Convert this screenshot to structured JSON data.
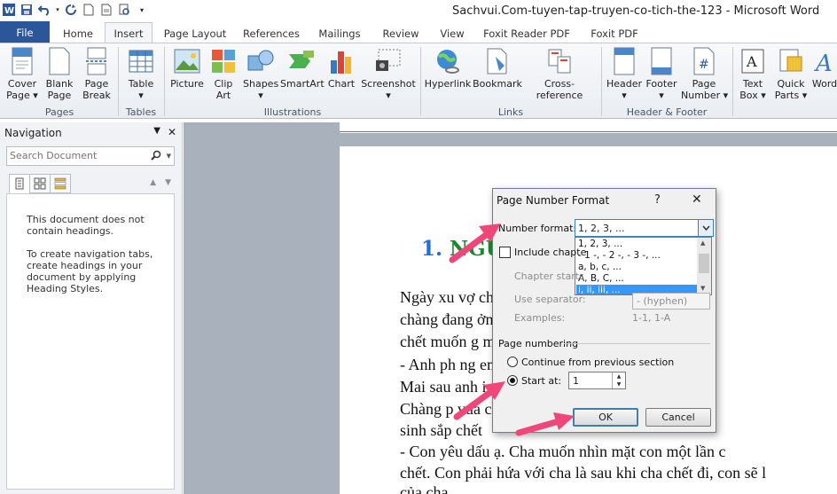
{
  "window": {
    "title": "Sachvui.Com-tuyen-tap-truyen-co-tich-the-123  -  Microsoft Word"
  },
  "tabs": [
    {
      "label": "File"
    },
    {
      "label": "Home"
    },
    {
      "label": "Insert"
    },
    {
      "label": "Page Layout"
    },
    {
      "label": "References"
    },
    {
      "label": "Mailings"
    },
    {
      "label": "Review"
    },
    {
      "label": "View"
    },
    {
      "label": "Foxit Reader PDF"
    },
    {
      "label": "Foxit PDF"
    }
  ],
  "ribbon": {
    "pages": {
      "label": "Pages",
      "cover": "Cover\nPage ▾",
      "blank": "Blank\nPage",
      "break": "Page\nBreak"
    },
    "tables": {
      "label": "Tables",
      "table": "Table\n▾"
    },
    "illustrations": {
      "label": "Illustrations",
      "picture": "Picture",
      "clipart": "Clip\nArt",
      "shapes": "Shapes\n▾",
      "smartart": "SmartArt",
      "chart": "Chart",
      "screenshot": "Screenshot\n▾"
    },
    "links": {
      "label": "Links",
      "hyperlink": "Hyperlink",
      "bookmark": "Bookmark",
      "crossref": "Cross-reference"
    },
    "header_footer": {
      "label": "Header & Footer",
      "header": "Header\n▾",
      "footer": "Footer\n▾",
      "pagenumber": "Page\nNumber ▾"
    },
    "text": {
      "textbox": "Text\nBox ▾",
      "quickparts": "Quick\nParts ▾",
      "wordart": "Word"
    }
  },
  "navigation": {
    "title": "Navigation",
    "search_placeholder": "Search Document",
    "msg1": "This document does not contain headings.",
    "msg2": "To create navigation tabs, create headings in your document by applying Heading Styles."
  },
  "document": {
    "heading_num": "1.",
    "heading_text": "NGU",
    "lines": [
      "Ngày xu                                    vợ chưa cưới th",
      "chàng đang                                ởng thì nhận đ",
      "chết muốn g                               mắt. Chàng bảo",
      "   - Anh ph                                 ng em chiếc nhẫ",
      "Mai sau anh                                 i đón em.",
      "   Chàng                                     p vua cha thì vu",
      "sinh sắp chết",
      "   - Con yêu dấu ạ. Cha muốn nhìn mặt con một lần c",
      "chết. Con phải hứa với cha là sau khi cha chết đi, con sẽ l",
      "của cha."
    ]
  },
  "dialog": {
    "title": "Page Number Format",
    "help": "?",
    "number_format_label": "Number format:",
    "number_format_value": "1, 2, 3, ...",
    "format_options": [
      "1, 2, 3, ...",
      "- 1 -, - 2 -, - 3 -, ...",
      "a, b, c, ...",
      "A, B, C, ...",
      "i, ii, iii, ..."
    ],
    "include_chapter_label": "Include chapte",
    "chapter_starts_label": "Chapter starts",
    "use_separator_label": "Use separator:",
    "separator_value": "-   (hyphen)",
    "examples_label": "Examples:",
    "examples_value": "1-1, 1-A",
    "page_numbering_label": "Page numbering",
    "continue_label": "Continue from previous section",
    "start_at_label": "Start at:",
    "start_at_value": "1",
    "ok_label": "OK",
    "cancel_label": "Cancel"
  },
  "colors": {
    "file_tab": "#2b579a",
    "annotation_arrow": "#f0467a",
    "heading_num": "#1f6fd4",
    "heading_text": "#1a8a2e",
    "selection": "#3399ff"
  }
}
